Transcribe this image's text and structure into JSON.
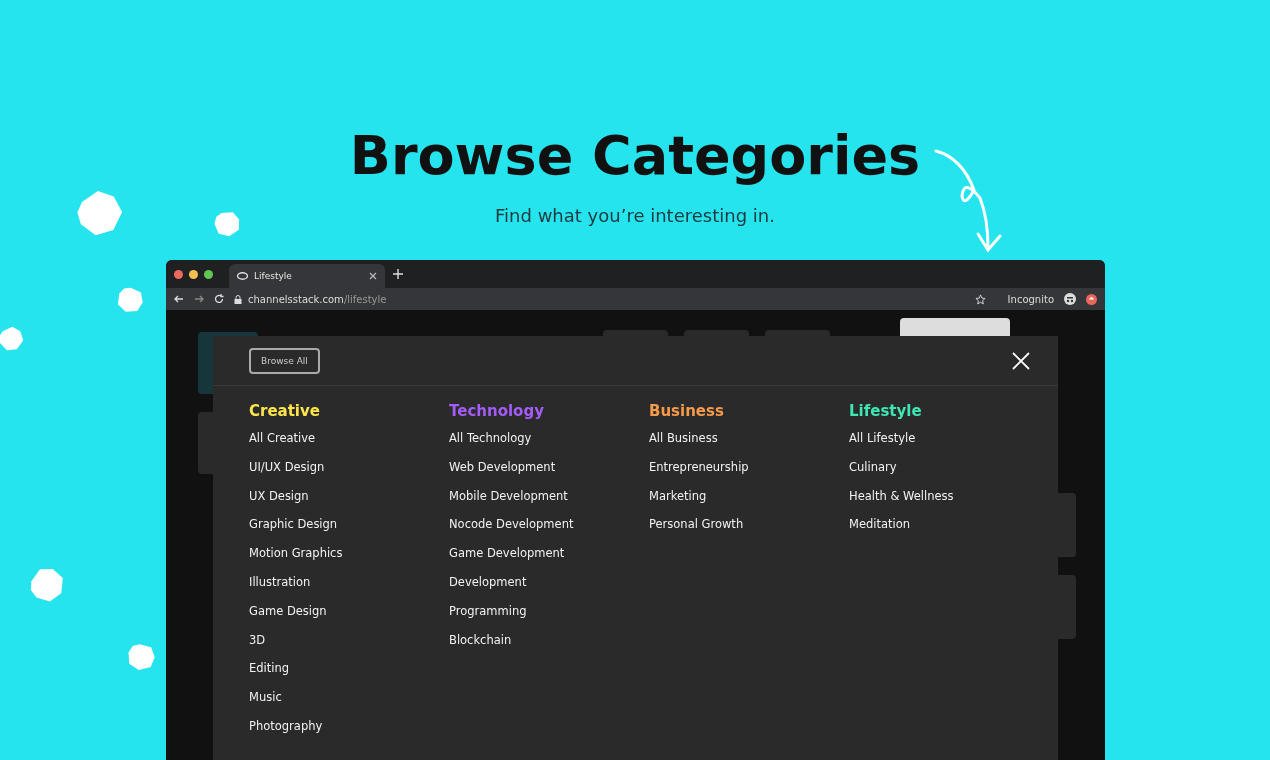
{
  "hero": {
    "title": "Browse Categories",
    "subtitle": "Find what you’re interesting in."
  },
  "browser": {
    "tab": {
      "title": "Lifestyle"
    },
    "url": {
      "host": "channelsstack.com",
      "path": "/lifestyle"
    },
    "profile": "Incognito"
  },
  "modal": {
    "browse_all": "Browse All",
    "categories": [
      {
        "title": "Creative",
        "color": "#fde54c",
        "items": [
          "All Creative",
          "UI/UX Design",
          "UX Design",
          "Graphic Design",
          "Motion Graphics",
          "Illustration",
          "Game Design",
          "3D",
          "Editing",
          "Music",
          "Photography"
        ]
      },
      {
        "title": "Technology",
        "color": "#a35cf5",
        "items": [
          "All Technology",
          "Web Development",
          "Mobile Development",
          "Nocode Development",
          "Game Development",
          "Development",
          "Programming",
          "Blockchain"
        ]
      },
      {
        "title": "Business",
        "color": "#f79a4a",
        "items": [
          "All Business",
          "Entrepreneurship",
          "Marketing",
          "Personal Growth"
        ]
      },
      {
        "title": "Lifestyle",
        "color": "#3ee6b4",
        "items": [
          "All Lifestyle",
          "Culinary",
          "Health & Wellness",
          "Meditation"
        ]
      }
    ]
  }
}
